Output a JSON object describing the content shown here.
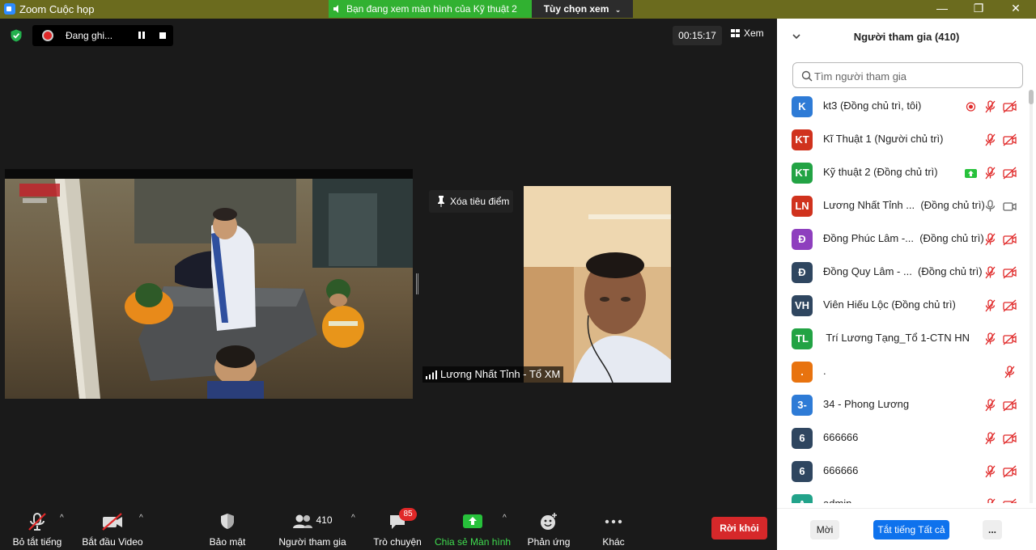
{
  "window": {
    "title": "Zoom Cuộc họp",
    "viewing_banner": "Bạn đang xem màn hình của Kỹ thuật 2",
    "view_options": "Tùy chọn xem",
    "minimize": "—",
    "maximize": "❐",
    "close": "✕"
  },
  "recording": {
    "label": "Đang ghi..."
  },
  "timer": "00:15:17",
  "view_label": "Xem",
  "unpin_label": "Xóa tiêu điểm",
  "video_name": "Lương Nhất Tỉnh - Tổ XM",
  "toolbar": {
    "mute_all": "Bỏ tắt tiếng",
    "start_video": "Bắt đầu Video",
    "security": "Bảo mật",
    "participants": "Người tham gia",
    "participants_count": "410",
    "chat": "Trò chuyện",
    "chat_badge": "85",
    "share_screen": "Chia sẻ Màn hình",
    "reactions": "Phản ứng",
    "more": "Khác",
    "leave": "Rời khỏi",
    "caret": "^"
  },
  "panel": {
    "title": "Người tham gia (410)",
    "search_placeholder": "Tìm người tham gia",
    "participants": [
      {
        "initials": "K",
        "name": "kt3 (Đồng chủ trì, tôi)",
        "color": "#2e7bd6",
        "recording": true,
        "mic": "muted",
        "video": "off"
      },
      {
        "initials": "KT",
        "name": "Kĩ Thuật 1 (Người chủ trì)",
        "color": "#d0321d",
        "mic": "muted",
        "video": "off"
      },
      {
        "initials": "KT",
        "name": "Kỹ thuật 2 (Đồng chủ trì)",
        "color": "#22a344",
        "sharing": true,
        "mic": "muted",
        "video": "off"
      },
      {
        "initials": "LN",
        "name": "Lương Nhất Tỉnh ...  (Đồng chủ trì)",
        "color": "#d0321d",
        "mic": "on",
        "video": "on"
      },
      {
        "initials": "Đ",
        "name": "Đồng Phúc Lâm -...  (Đồng chủ trì)",
        "color": "#8e3fbe",
        "mic": "muted",
        "video": "off"
      },
      {
        "initials": "Đ",
        "name": "Đồng Quy Lâm - ...  (Đồng chủ trì)",
        "color": "#2f4660",
        "mic": "muted",
        "video": "off"
      },
      {
        "initials": "VH",
        "name": "Viên Hiếu Lộc (Đồng chủ trì)",
        "color": "#2f4660",
        "mic": "muted",
        "video": "off"
      },
      {
        "initials": "TL",
        "name": " Trí Lương Tạng_Tổ 1-CTN HN",
        "color": "#22a344",
        "mic": "muted",
        "video": "off"
      },
      {
        "initials": ".",
        "name": ".",
        "color": "#e8730f",
        "mic": "muted",
        "video": "none"
      },
      {
        "initials": "3-",
        "name": "34 - Phong Lương",
        "color": "#2e7bd6",
        "mic": "muted",
        "video": "off"
      },
      {
        "initials": "6",
        "name": "666666",
        "color": "#2f4660",
        "mic": "muted",
        "video": "off"
      },
      {
        "initials": "6",
        "name": "666666",
        "color": "#2f4660",
        "mic": "muted",
        "video": "off"
      },
      {
        "initials": "A",
        "name": "admin",
        "color": "#22a38a",
        "mic": "muted",
        "video": "off"
      }
    ],
    "invite": "Mời",
    "mute_all": "Tắt tiếng Tất cả",
    "more": "..."
  },
  "colors": {
    "accent": "#0e72ed",
    "leave": "#d6282a",
    "share_green": "#27c13b",
    "muted_red": "#e02828"
  }
}
